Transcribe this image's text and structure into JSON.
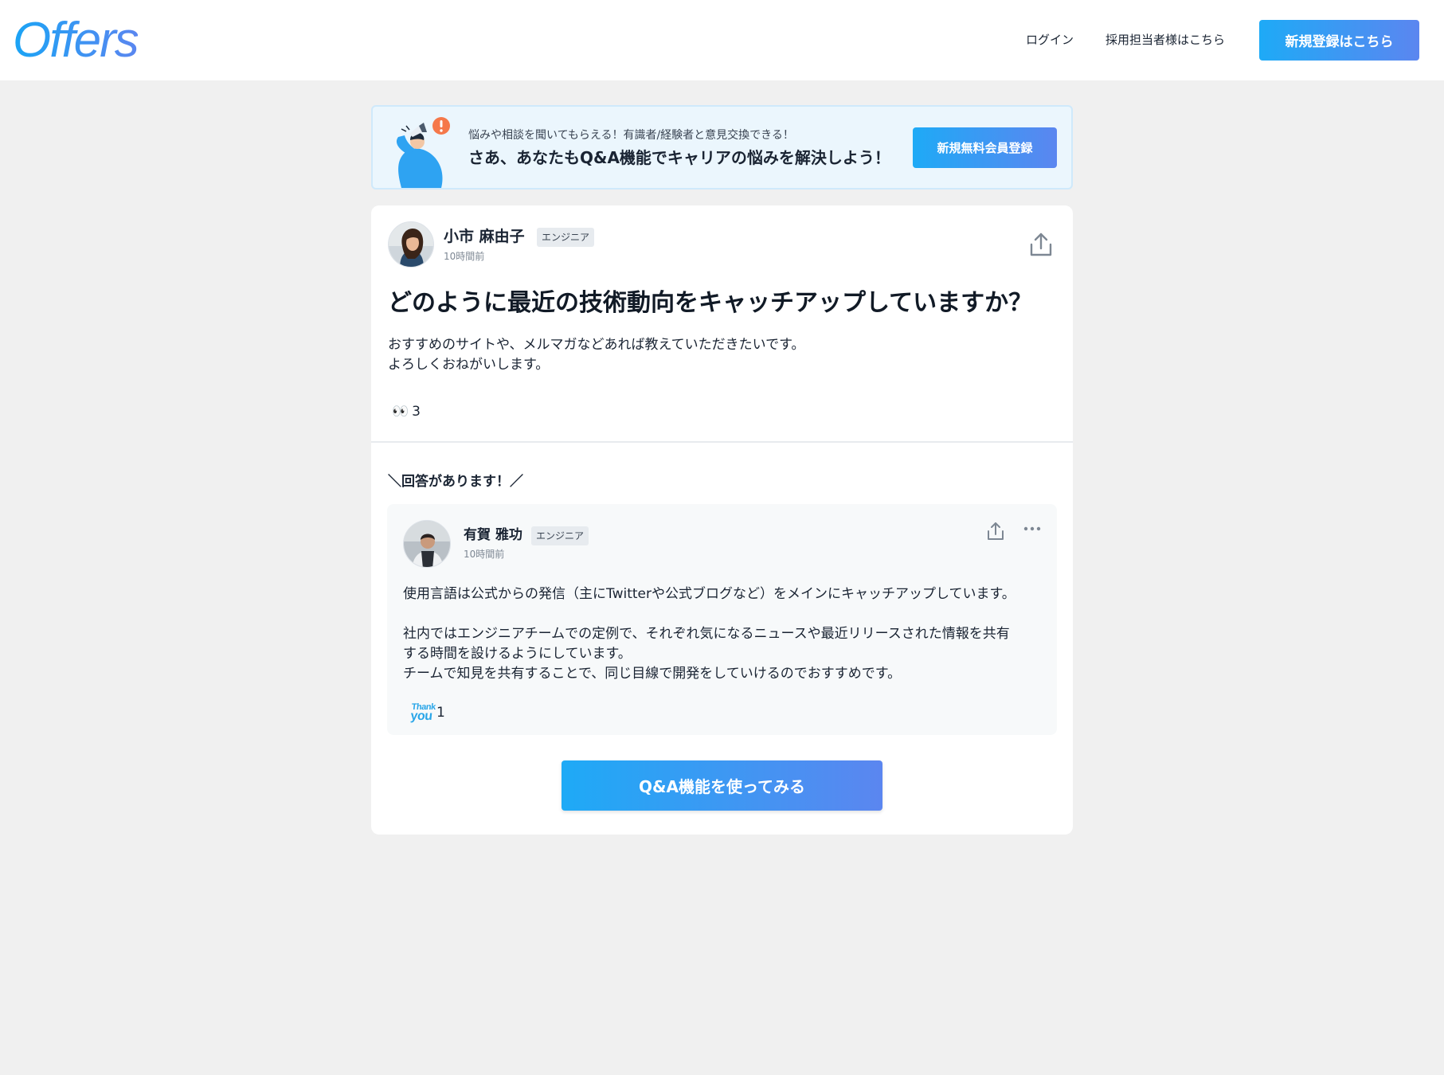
{
  "header": {
    "logo": "Offers",
    "nav": {
      "login": "ログイン",
      "recruiter": "採用担当者様はこちら"
    },
    "signup_button": "新規登録はこちら"
  },
  "banner": {
    "subtitle": "悩みや相談を聞いてもらえる！有識者/経験者と意見交換できる！",
    "title": "さあ、あなたもQ&A機能でキャリアの悩みを解決しよう！",
    "button": "新規無料会員登録"
  },
  "question": {
    "author": "小市 麻由子",
    "role": "エンジニア",
    "time": "10時間前",
    "title": "どのように最近の技術動向をキャッチアップしていますか？",
    "body": [
      "おすすめのサイトや、メルマガなどあれば教えていただきたいです。",
      "よろしくおねがいします。"
    ],
    "reaction_emoji": "👀",
    "reaction_count": "3"
  },
  "answers_heading": "＼回答があります！／",
  "answer": {
    "author": "有賀 雅功",
    "role": "エンジニア",
    "time": "10時間前",
    "body": [
      "使用言語は公式からの発信（主にTwitterや公式ブログなど）をメインにキャッチアップしています。",
      "",
      "社内ではエンジニアチームでの定例で、それぞれ気になるニュースや最近リリースされた情報を共有",
      "する時間を設けるようにしています。",
      "チームで知見を共有することで、同じ目線で開発をしていけるのでおすすめです。"
    ],
    "reaction_sticker": {
      "line1": "Thank",
      "line2": "you"
    },
    "reaction_count": "1"
  },
  "cta_button": "Q&A機能を使ってみる",
  "colors": {
    "accent_start": "#1eaaf6",
    "accent_end": "#5b86f0",
    "page_bg": "#f0f0f0"
  },
  "icons": [
    "share-icon",
    "more-icon",
    "megaphone-illustration"
  ]
}
